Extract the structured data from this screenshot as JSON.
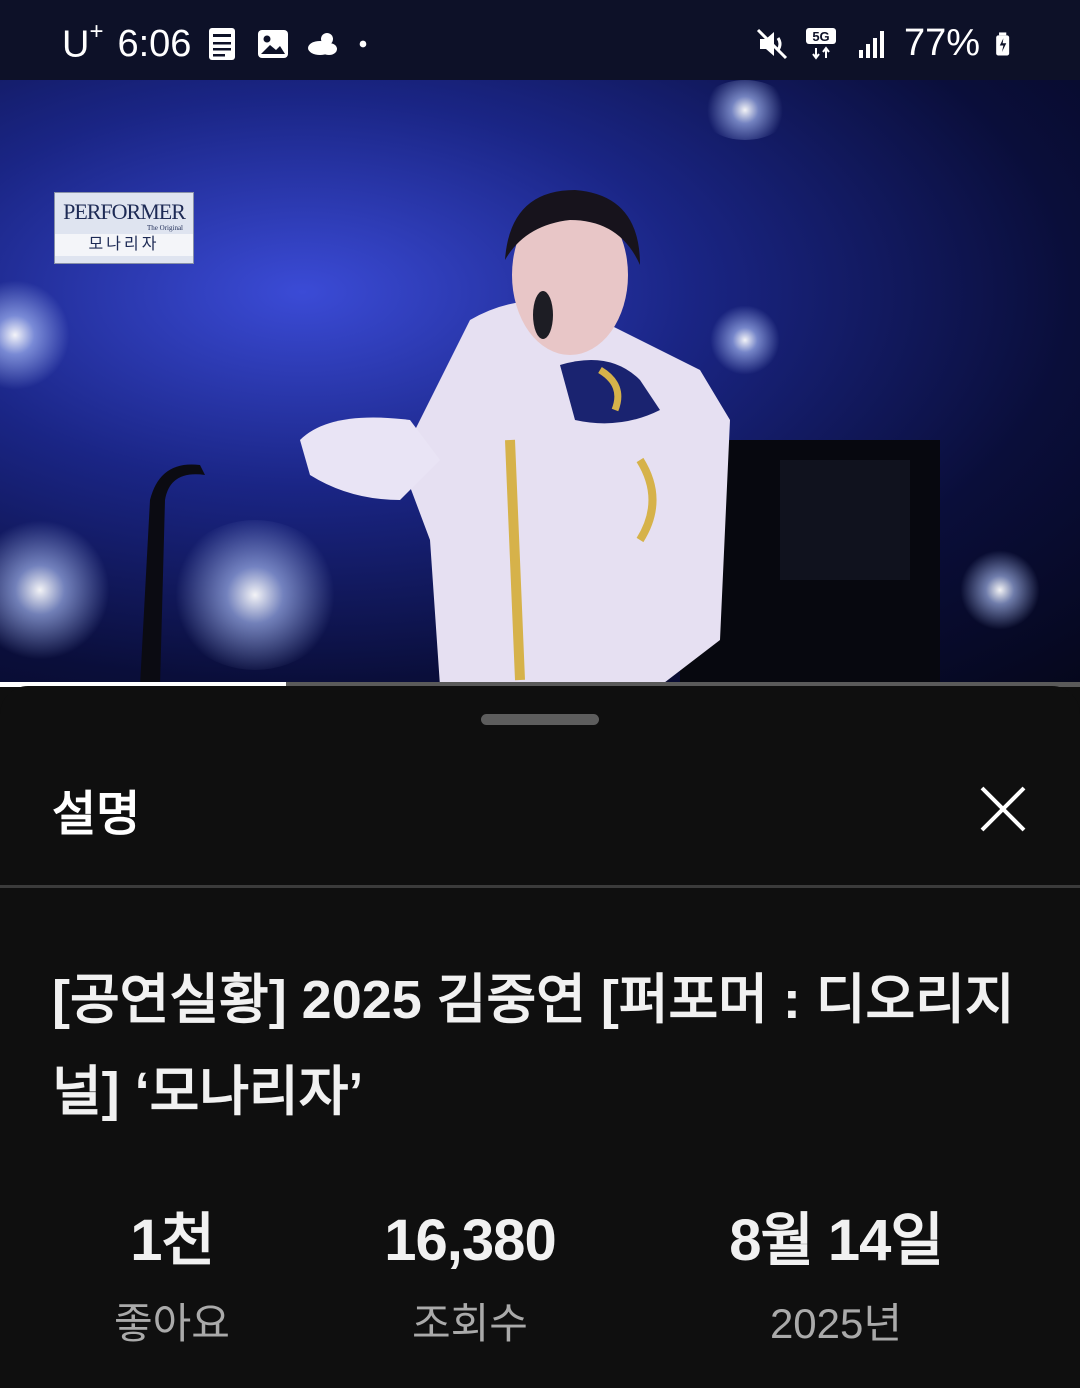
{
  "status_bar": {
    "carrier": "U",
    "carrier_sup": "+",
    "time": "6:06",
    "battery": "77%",
    "network": "5G",
    "icons": [
      "pdf-icon",
      "image-icon",
      "weather-icon",
      "dot-icon",
      "mute-icon",
      "signal-icon",
      "battery-icon"
    ]
  },
  "video": {
    "logo_line1": "PERFORMER",
    "logo_line2": "The Original",
    "logo_line3": "모나리자",
    "progress": 0.265
  },
  "sheet": {
    "title": "설명",
    "video_title": "[공연실황] 2025 김중연 [퍼포머 : 디오리지널] ‘모나리자’",
    "stats": [
      {
        "value": "1천",
        "label": "좋아요"
      },
      {
        "value": "16,380",
        "label": "조회수"
      },
      {
        "value": "8월 14일",
        "label": "2025년"
      }
    ]
  },
  "colors": {
    "background": "#0f0f0f",
    "status_bar": "#0d1128",
    "secondary_text": "#aaaaaa",
    "divider": "#3b3b3b"
  }
}
